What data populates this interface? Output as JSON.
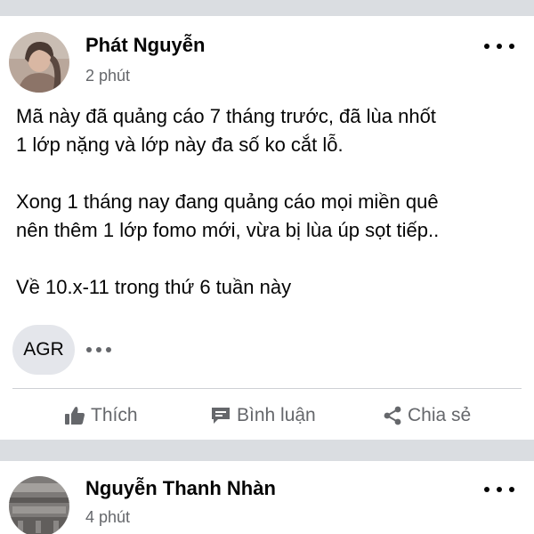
{
  "posts": [
    {
      "author": "Phát Nguyễn",
      "time": "2 phút",
      "paragraphs": [
        [
          "Mã này đã quảng cáo 7 tháng trước, đã lùa nhốt",
          "1 lớp nặng và lớp này đa số ko cắt lỗ."
        ],
        [
          "Xong 1 tháng nay đang quảng cáo mọi miền quê",
          "nên thêm 1 lớp fomo mới, vừa bị lùa úp sọt tiếp.."
        ],
        [
          "Về 10.x-11 trong thứ 6 tuần này"
        ]
      ],
      "tag": "AGR",
      "actions": {
        "like": "Thích",
        "comment": "Bình luận",
        "share": "Chia sẻ"
      }
    },
    {
      "author": "Nguyễn Thanh Nhàn",
      "time": "4 phút"
    }
  ],
  "icons": {
    "like": "thumbs-up-icon",
    "comment": "comment-bubble-icon",
    "share": "share-icon",
    "more": "more-horizontal-icon"
  },
  "colors": {
    "divider": "#dadde1",
    "secondary_text": "#65676b",
    "chip_bg": "#e4e6eb"
  }
}
